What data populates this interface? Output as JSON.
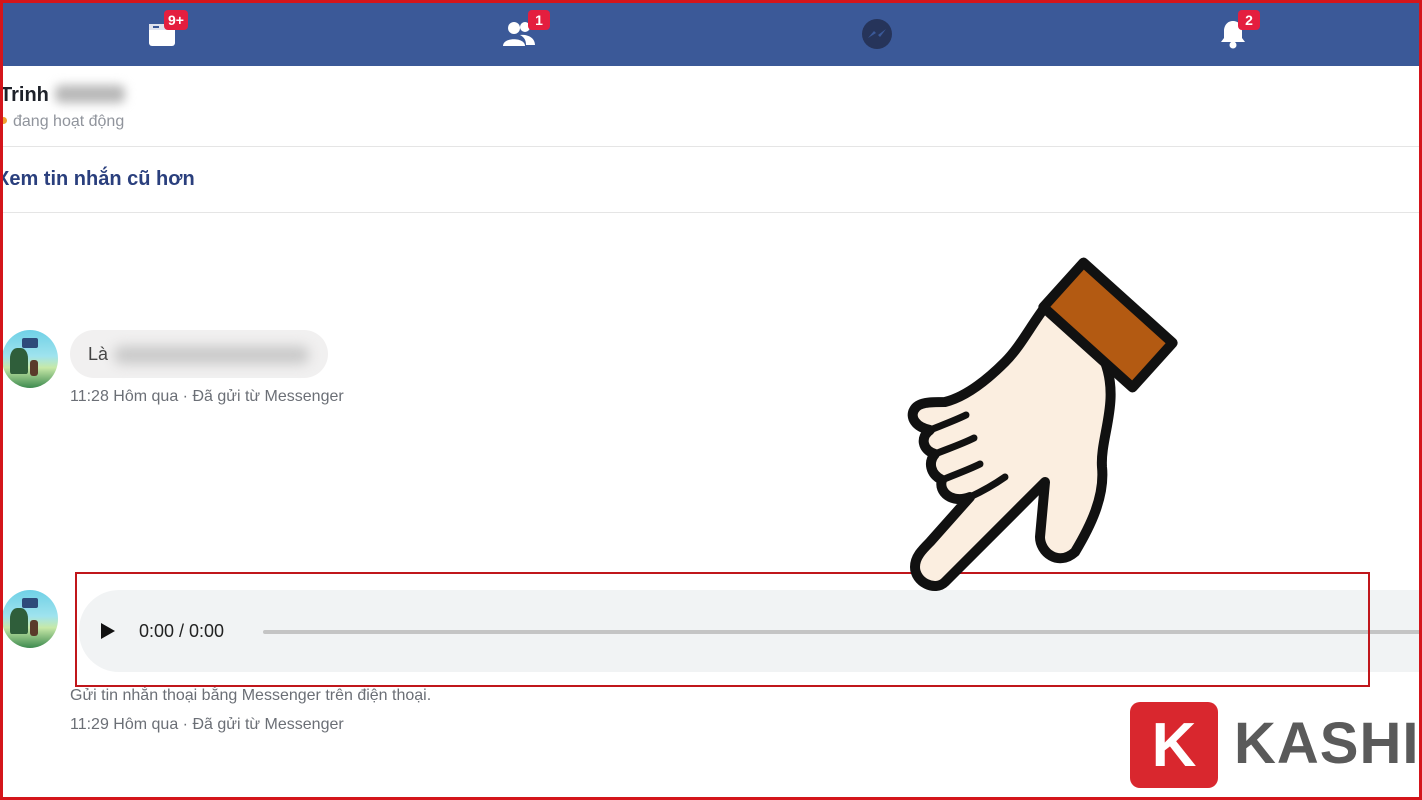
{
  "topnav": {
    "background": "#3b5998",
    "items": [
      {
        "icon": "news-feed-icon",
        "badge": "9+"
      },
      {
        "icon": "friends-icon",
        "badge": "1"
      },
      {
        "icon": "messenger-icon",
        "badge": ""
      },
      {
        "icon": "notifications-bell-icon",
        "badge": "2"
      }
    ]
  },
  "chat_header": {
    "name": "Trinh",
    "status": "đang hoạt động"
  },
  "older_messages_link": "Xem tin nhắn cũ hơn",
  "messages": [
    {
      "text_visible": "Là",
      "meta": "11:28 Hôm qua · Đã gửi từ Messenger"
    },
    {
      "audio_time": "0:00 / 0:00",
      "caption": "Gửi tin nhắn thoại bằng Messenger trên điện thoại.",
      "meta": "11:29 Hôm qua · Đã gửi từ Messenger"
    }
  ],
  "logo": {
    "letter": "K",
    "word": "KASHI",
    "accent": "#d9272e"
  },
  "highlight_color": "#c0161b"
}
